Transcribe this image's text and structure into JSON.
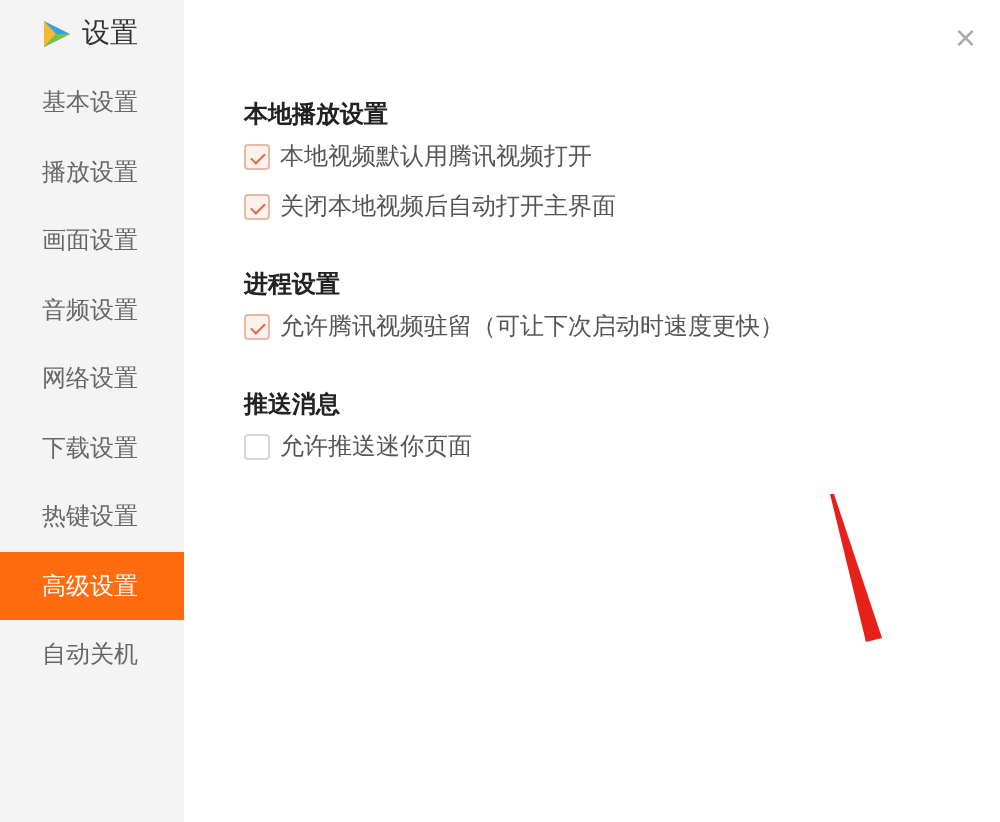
{
  "window": {
    "title": "设置"
  },
  "sidebar": {
    "items": [
      {
        "label": "基本设置",
        "selected": false
      },
      {
        "label": "播放设置",
        "selected": false
      },
      {
        "label": "画面设置",
        "selected": false
      },
      {
        "label": "音频设置",
        "selected": false
      },
      {
        "label": "网络设置",
        "selected": false
      },
      {
        "label": "下载设置",
        "selected": false
      },
      {
        "label": "热键设置",
        "selected": false
      },
      {
        "label": "高级设置",
        "selected": true
      },
      {
        "label": "自动关机",
        "selected": false
      }
    ]
  },
  "sections": [
    {
      "title": "本地播放设置",
      "options": [
        {
          "label": "本地视频默认用腾讯视频打开",
          "checked": true
        },
        {
          "label": "关闭本地视频后自动打开主界面",
          "checked": true
        }
      ]
    },
    {
      "title": "进程设置",
      "options": [
        {
          "label": "允许腾讯视频驻留（可让下次启动时速度更快）",
          "checked": true
        }
      ]
    },
    {
      "title": "推送消息",
      "options": [
        {
          "label": "允许推送迷你页面",
          "checked": false
        }
      ]
    }
  ],
  "close_button": {
    "label": "×"
  }
}
